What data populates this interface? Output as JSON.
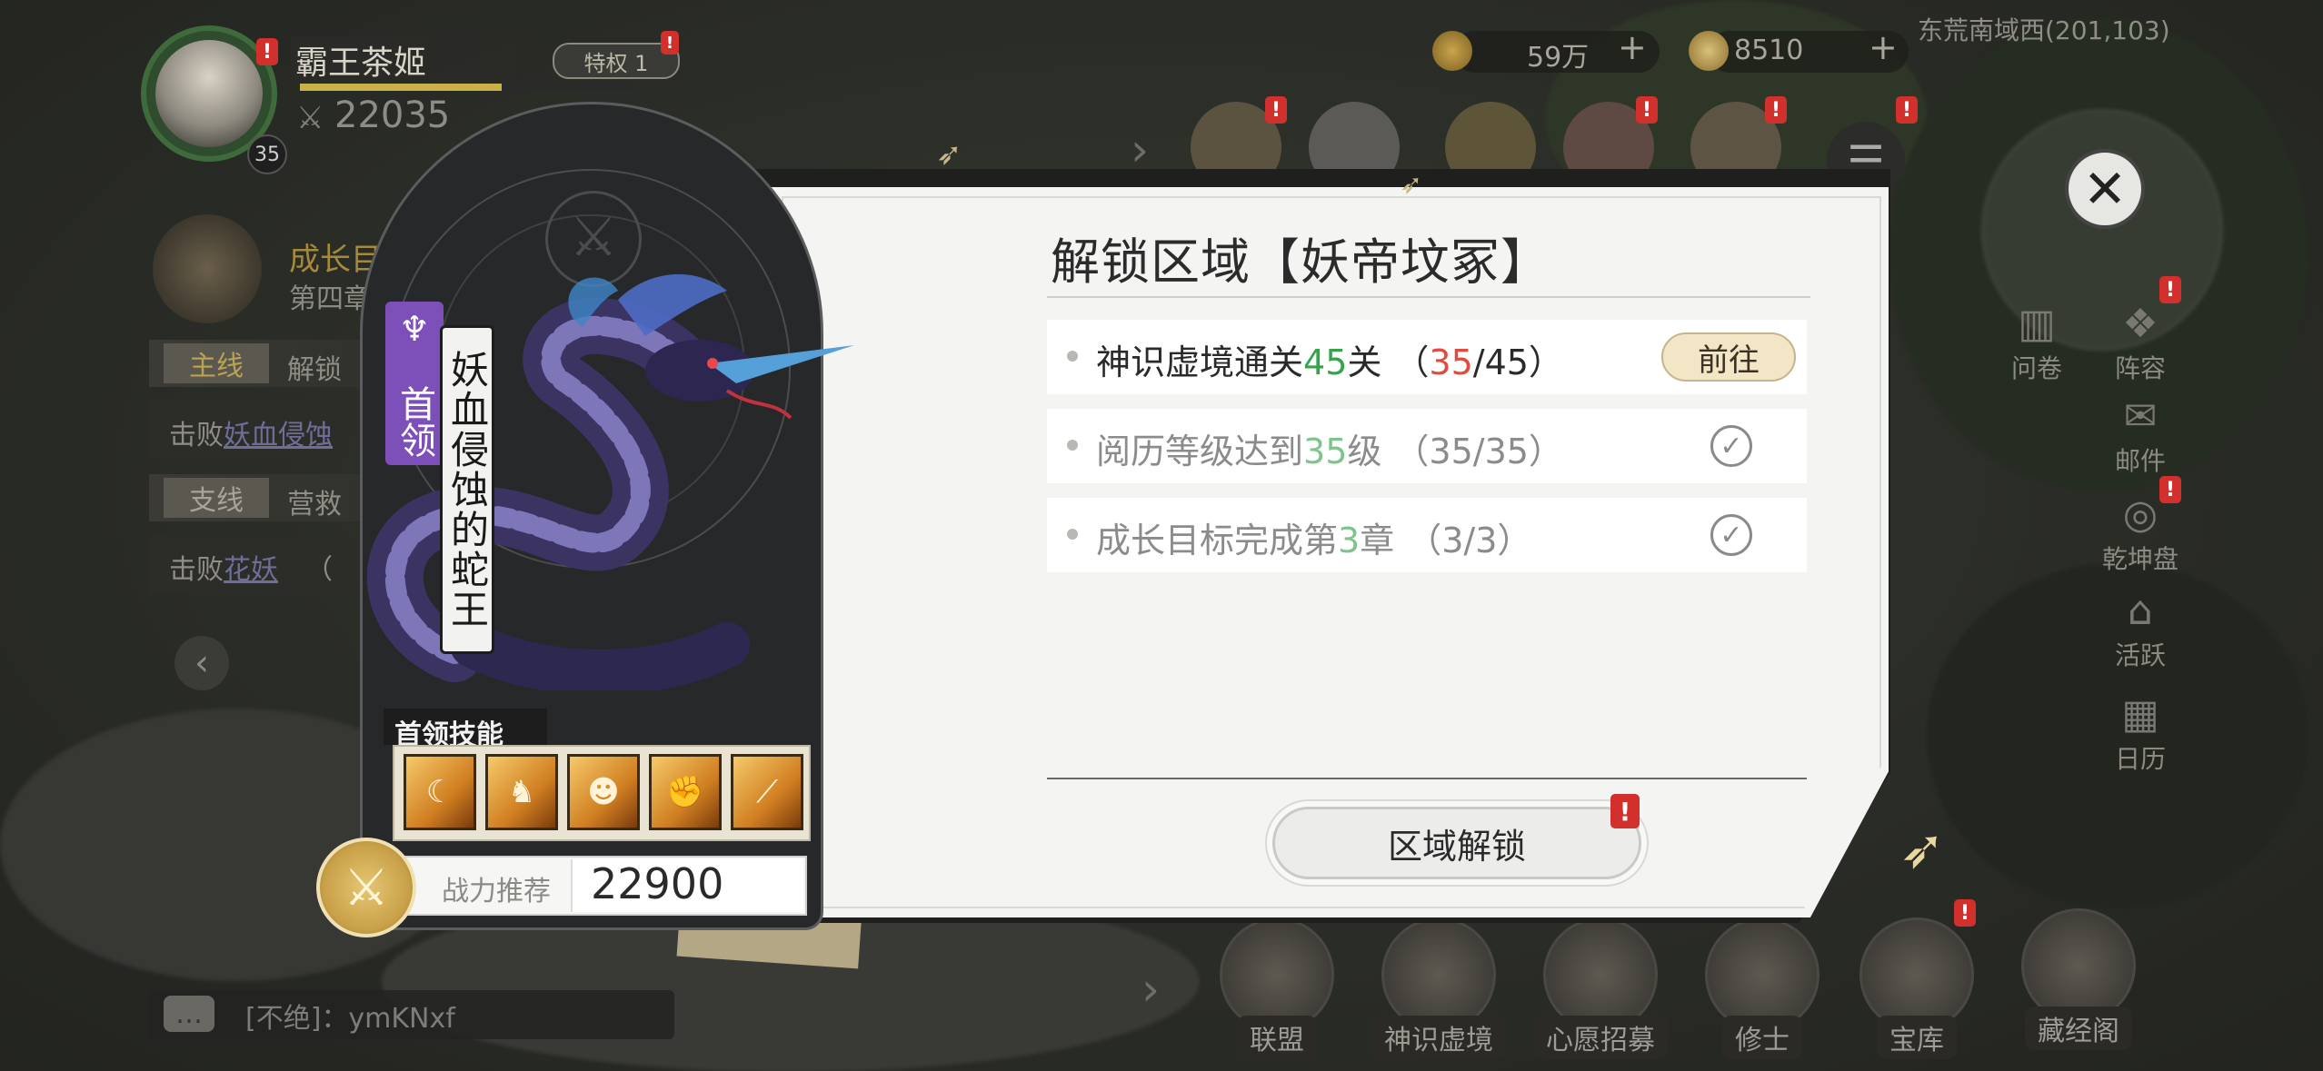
{
  "player": {
    "name": "霸王茶姬",
    "vip": "特权 1",
    "level": "35",
    "power": "22035",
    "exp_fraction": 0.6
  },
  "currency": {
    "coins": "59万",
    "gems": "8510"
  },
  "location": "东荒南域西(201,103)",
  "quest": {
    "title": "成长目",
    "chapter": "第四章",
    "main_tag": "主线",
    "main_title": "解锁",
    "main_desc_prefix": "击败",
    "main_desc_target": "妖血侵蚀",
    "branch_tag": "支线",
    "branch_title": "营救",
    "branch_desc_prefix": "击败",
    "branch_desc_target": "花妖",
    "branch_desc_suffix": "（"
  },
  "side_icons": [
    "问卷",
    "阵容",
    "邮件",
    "乾坤盘",
    "活跃",
    "日历"
  ],
  "bottom_nav": [
    "联盟",
    "神识虚境",
    "心愿招募",
    "修士",
    "宝库",
    "藏经阁"
  ],
  "chat": {
    "text": "[不绝]：ymKNxf"
  },
  "boss_card": {
    "tag": "首领",
    "name": "妖血侵蚀的蛇王",
    "skills_label": "首领技能",
    "rec_label": "战力推荐",
    "rec_value": "22900"
  },
  "dialog": {
    "title": "解锁区域【妖帝坟冢】",
    "conditions": [
      {
        "pre": "神识虚境通关",
        "num": "45",
        "post": "关",
        "prog_open": "（",
        "prog_cur": "35",
        "prog_rest": "/45）",
        "done": false,
        "action": "前往"
      },
      {
        "pre": "阅历等级达到",
        "num": "35",
        "post": "级",
        "prog_open": "（",
        "prog_cur": "35",
        "prog_rest": "/35）",
        "done": true
      },
      {
        "pre": "成长目标完成第",
        "num": "3",
        "post": "章",
        "prog_open": "（",
        "prog_cur": "3",
        "prog_rest": "/3）",
        "done": true
      }
    ],
    "unlock_button": "区域解锁"
  },
  "colors": {
    "accent_green": "#35a34a",
    "progress_red": "#e24a3d",
    "boss_purple": "#7d4fb8",
    "alert_red": "#d2302c"
  }
}
